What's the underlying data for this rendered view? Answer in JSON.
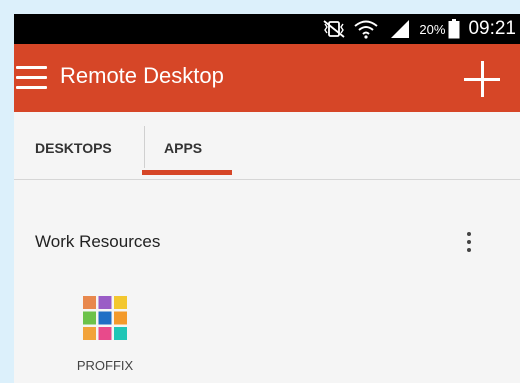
{
  "status_bar": {
    "battery_percent": "20%",
    "time": "09:21",
    "icons": [
      "mute-vibrate-icon",
      "wifi-icon",
      "signal-icon",
      "battery-icon"
    ]
  },
  "app_bar": {
    "title": "Remote Desktop",
    "color": "#d64627",
    "menu_icon": "hamburger-menu-icon",
    "add_icon": "plus-icon"
  },
  "tabs": [
    {
      "label": "DESKTOPS",
      "selected": false
    },
    {
      "label": "APPS",
      "selected": true
    }
  ],
  "section": {
    "title": "Work Resources",
    "overflow_icon": "more-vert-icon"
  },
  "apps": [
    {
      "label": "PROFFIX",
      "icon": "proffix-grid-icon",
      "grid_colors": [
        "#e8884d",
        "#9a5cc6",
        "#f3c72f",
        "#6cc24a",
        "#1f6fc5",
        "#f39a2b",
        "#f2a33a",
        "#e84a8b",
        "#20c6b6"
      ]
    }
  ]
}
